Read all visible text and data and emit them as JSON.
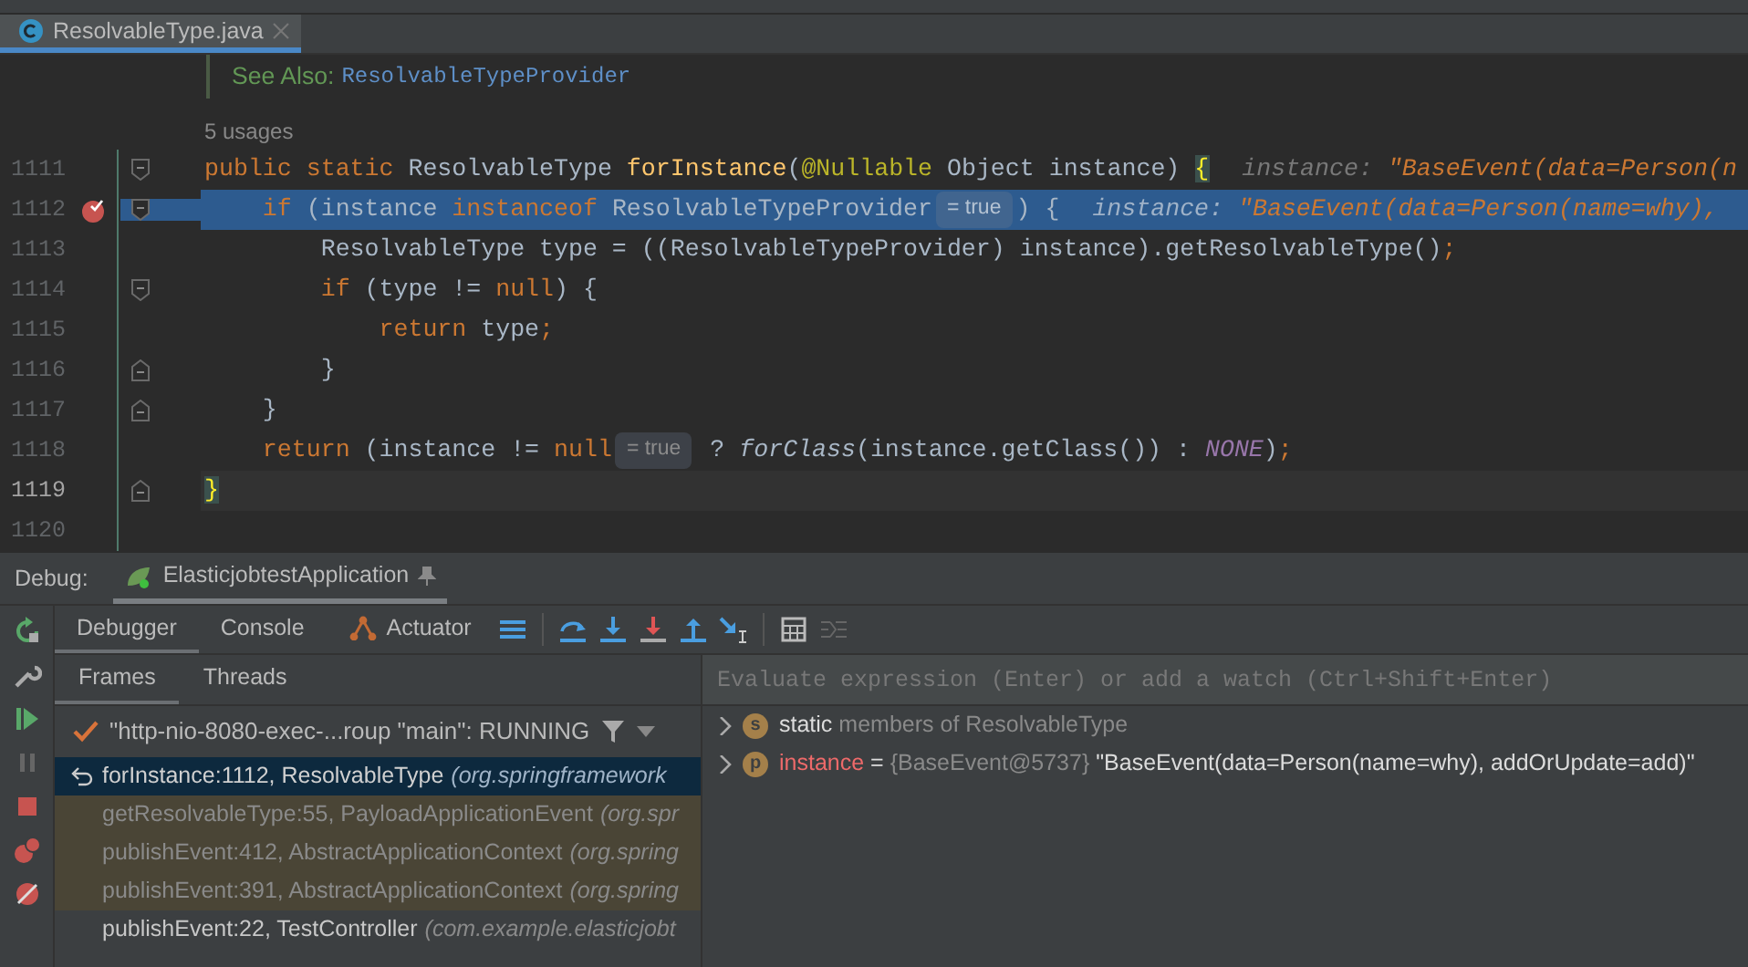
{
  "editor_tab": {
    "title": "ResolvableType.java",
    "selected": true
  },
  "editor": {
    "doc": {
      "label": "See Also:",
      "link": "ResolvableTypeProvider"
    },
    "usages": "5 usages",
    "lines": [
      {
        "number": "1111",
        "breakpoint": false,
        "fold_start": true,
        "fold_end": false,
        "execution_point": false,
        "caret_line": false,
        "segments": [
          {
            "kind": "code",
            "tokens": [
              {
                "kind": "keyword",
                "text": "public static "
              },
              {
                "kind": "plain",
                "text": "ResolvableType "
              },
              {
                "kind": "method",
                "text": "forInstance"
              },
              {
                "kind": "plain",
                "text": "("
              },
              {
                "kind": "annotation",
                "text": "@Nullable"
              },
              {
                "kind": "plain",
                "text": " Object instance) "
              },
              {
                "kind": "brace",
                "text": "{"
              }
            ]
          },
          {
            "kind": "hint",
            "label": "instance:",
            "value": "\"BaseEvent(data=Person(n"
          }
        ]
      },
      {
        "number": "1112",
        "breakpoint": true,
        "fold_start": true,
        "fold_end": false,
        "execution_point": true,
        "caret_line": false,
        "segments": [
          {
            "kind": "code",
            "tokens": [
              {
                "kind": "keyword",
                "text": "    if"
              },
              {
                "kind": "plain",
                "text": " (instance "
              },
              {
                "kind": "keyword",
                "text": "instanceof"
              },
              {
                "kind": "plain",
                "text": " ResolvableTypeProvider"
              }
            ]
          },
          {
            "kind": "inlay",
            "text": "= true"
          },
          {
            "kind": "code",
            "tokens": [
              {
                "kind": "plain",
                "text": ") {"
              }
            ]
          },
          {
            "kind": "hint",
            "label": "instance:",
            "value": "\"BaseEvent(data=Person(name=why),"
          }
        ]
      },
      {
        "number": "1113",
        "breakpoint": false,
        "fold_start": false,
        "fold_end": false,
        "execution_point": false,
        "caret_line": false,
        "segments": [
          {
            "kind": "code",
            "tokens": [
              {
                "kind": "plain",
                "text": "        ResolvableType type = ((ResolvableTypeProvider) instance).getResolvableType()"
              },
              {
                "kind": "keyword",
                "text": ";"
              }
            ]
          }
        ]
      },
      {
        "number": "1114",
        "breakpoint": false,
        "fold_start": true,
        "fold_end": false,
        "execution_point": false,
        "caret_line": false,
        "segments": [
          {
            "kind": "code",
            "tokens": [
              {
                "kind": "keyword",
                "text": "        if"
              },
              {
                "kind": "plain",
                "text": " (type != "
              },
              {
                "kind": "keyword",
                "text": "null"
              },
              {
                "kind": "plain",
                "text": ") {"
              }
            ]
          }
        ]
      },
      {
        "number": "1115",
        "breakpoint": false,
        "fold_start": false,
        "fold_end": false,
        "execution_point": false,
        "caret_line": false,
        "segments": [
          {
            "kind": "code",
            "tokens": [
              {
                "kind": "keyword",
                "text": "            return"
              },
              {
                "kind": "plain",
                "text": " type"
              },
              {
                "kind": "keyword",
                "text": ";"
              }
            ]
          }
        ]
      },
      {
        "number": "1116",
        "breakpoint": false,
        "fold_start": false,
        "fold_end": true,
        "execution_point": false,
        "caret_line": false,
        "segments": [
          {
            "kind": "code",
            "tokens": [
              {
                "kind": "plain",
                "text": "        }"
              }
            ]
          }
        ]
      },
      {
        "number": "1117",
        "breakpoint": false,
        "fold_start": false,
        "fold_end": true,
        "execution_point": false,
        "caret_line": false,
        "segments": [
          {
            "kind": "code",
            "tokens": [
              {
                "kind": "plain",
                "text": "    }"
              }
            ]
          }
        ]
      },
      {
        "number": "1118",
        "breakpoint": false,
        "fold_start": false,
        "fold_end": false,
        "execution_point": false,
        "caret_line": false,
        "segments": [
          {
            "kind": "code",
            "tokens": [
              {
                "kind": "keyword",
                "text": "    return"
              },
              {
                "kind": "plain",
                "text": " (instance != "
              },
              {
                "kind": "keyword",
                "text": "null"
              }
            ]
          },
          {
            "kind": "inlay",
            "text": "= true"
          },
          {
            "kind": "code",
            "tokens": [
              {
                "kind": "plain",
                "text": " ? "
              },
              {
                "kind": "italic",
                "text": "forClass"
              },
              {
                "kind": "plain",
                "text": "(instance.getClass()) : "
              },
              {
                "kind": "constant",
                "text": "NONE"
              },
              {
                "kind": "plain",
                "text": ")"
              },
              {
                "kind": "keyword",
                "text": ";"
              }
            ]
          }
        ]
      },
      {
        "number": "1119",
        "breakpoint": false,
        "fold_start": false,
        "fold_end": true,
        "execution_point": false,
        "caret_line": true,
        "segments": [
          {
            "kind": "code",
            "tokens": [
              {
                "kind": "brace",
                "text": "}"
              }
            ]
          }
        ]
      },
      {
        "number": "1120",
        "breakpoint": false,
        "fold_start": false,
        "fold_end": false,
        "execution_point": false,
        "caret_line": false
      }
    ]
  },
  "debug": {
    "label": "Debug:",
    "session": "ElasticjobtestApplication",
    "tabs": [
      {
        "label": "Debugger",
        "selected": true,
        "kind": "plain"
      },
      {
        "label": "Console",
        "selected": false,
        "kind": "plain"
      },
      {
        "label": "Actuator",
        "selected": false,
        "kind": "actuator"
      }
    ],
    "frame_tabs": [
      {
        "label": "Frames",
        "selected": true
      },
      {
        "label": "Threads",
        "selected": false
      }
    ],
    "thread": "\"http-nio-8080-exec-...roup \"main\": RUNNING",
    "frames": [
      {
        "method": "forInstance:1112, ResolvableType",
        "package": "(org.springframework",
        "selected": true,
        "library": false
      },
      {
        "method": "getResolvableType:55, PayloadApplicationEvent",
        "package": "(org.spr",
        "selected": false,
        "library": true
      },
      {
        "method": "publishEvent:412, AbstractApplicationContext",
        "package": "(org.spring",
        "selected": false,
        "library": true
      },
      {
        "method": "publishEvent:391, AbstractApplicationContext",
        "package": "(org.spring",
        "selected": false,
        "library": true
      },
      {
        "method": "publishEvent:22, TestController",
        "package": "(com.example.elasticjobt",
        "selected": false,
        "library": false
      }
    ],
    "evaluate_placeholder": "Evaluate expression (Enter) or add a watch (Ctrl+Shift+Enter)",
    "variables": [
      {
        "badge": "s",
        "name": "static",
        "kind": "static",
        "detail": "members of ResolvableType",
        "expanded": false
      },
      {
        "badge": "p",
        "name": "instance",
        "kind": "field",
        "operator": "=",
        "type": "{BaseEvent@5737}",
        "value": "\"BaseEvent(data=Person(name=why), addOrUpdate=add)\"",
        "expanded": false
      }
    ]
  }
}
